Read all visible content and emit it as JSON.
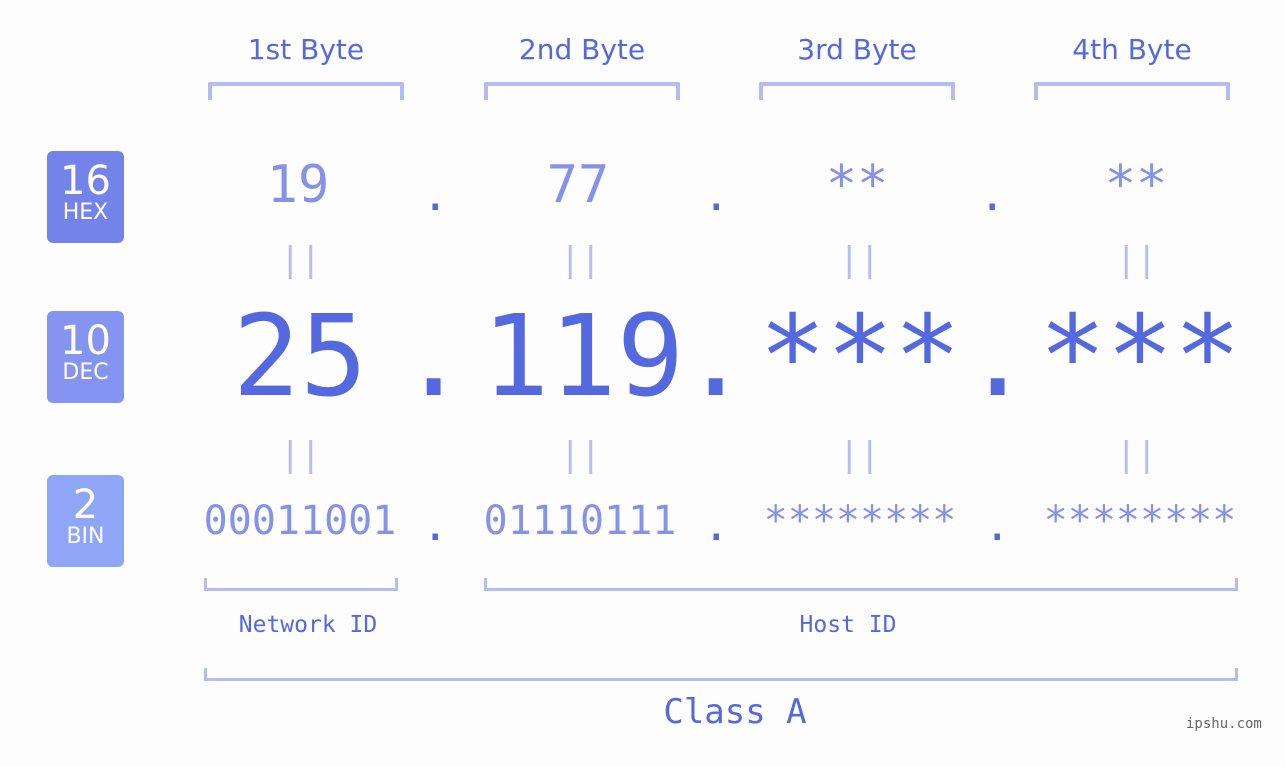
{
  "badges": [
    {
      "number": "16",
      "label": "HEX",
      "color": "#7383ea"
    },
    {
      "number": "10",
      "label": "DEC",
      "color": "#8594f0"
    },
    {
      "number": "2",
      "label": "BIN",
      "color": "#8fa6f7"
    }
  ],
  "bytes": [
    {
      "header": "1st Byte",
      "hex": "19",
      "dec": "25",
      "bin": "00011001"
    },
    {
      "header": "2nd Byte",
      "hex": "77",
      "dec": "119",
      "bin": "01110111"
    },
    {
      "header": "3rd Byte",
      "hex": "**",
      "dec": "***",
      "bin": "********"
    },
    {
      "header": "4th Byte",
      "hex": "**",
      "dec": "***",
      "bin": "********"
    }
  ],
  "separator": ".",
  "equals": "||",
  "network_label": "Network ID",
  "host_label": "Host ID",
  "class_label": "Class A",
  "watermark": "ipshu.com"
}
